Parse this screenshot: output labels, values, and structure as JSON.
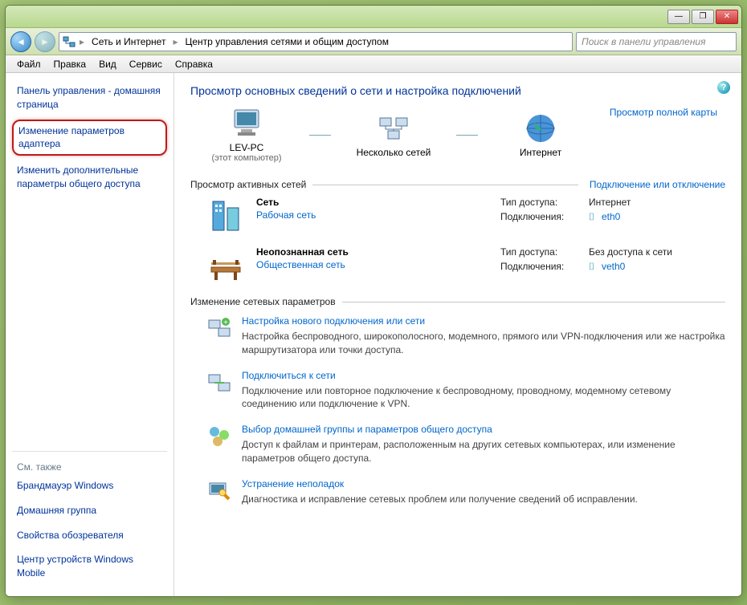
{
  "titlebar": {
    "min": "—",
    "max": "❐",
    "close": "✕"
  },
  "nav": {
    "back": "◄",
    "fwd": "►",
    "crumb1": "Сеть и Интернет",
    "crumb2": "Центр управления сетями и общим доступом",
    "search_placeholder": "Поиск в панели управления"
  },
  "menu": {
    "file": "Файл",
    "edit": "Правка",
    "view": "Вид",
    "service": "Сервис",
    "help": "Справка"
  },
  "sidebar": {
    "home": "Панель управления - домашняя страница",
    "adapter": "Изменение параметров адаптера",
    "advshare": "Изменить дополнительные параметры общего доступа",
    "seealso": "См. также",
    "firewall": "Брандмауэр Windows",
    "homegroup": "Домашняя группа",
    "browser": "Свойства обозревателя",
    "mobile": "Центр устройств Windows Mobile"
  },
  "content": {
    "heading": "Просмотр основных сведений о сети и настройка подключений",
    "fullmap": "Просмотр полной карты",
    "map": {
      "pc": "LEV-PC",
      "pc_sub": "(этот компьютер)",
      "multi": "Несколько сетей",
      "internet": "Интернет"
    },
    "activeHdr": "Просмотр активных сетей",
    "connToggle": "Подключение или отключение",
    "net1": {
      "title": "Сеть",
      "type": "Рабочая сеть",
      "accessK": "Тип доступа:",
      "accessV": "Интернет",
      "connK": "Подключения:",
      "connV": "eth0"
    },
    "net2": {
      "title": "Неопознанная сеть",
      "type": "Общественная сеть",
      "accessK": "Тип доступа:",
      "accessV": "Без доступа к сети",
      "connK": "Подключения:",
      "connV": "veth0"
    },
    "changeHdr": "Изменение сетевых параметров",
    "task1": {
      "title": "Настройка нового подключения или сети",
      "desc": "Настройка беспроводного, широкополосного, модемного, прямого или VPN-подключения или же настройка маршрутизатора или точки доступа."
    },
    "task2": {
      "title": "Подключиться к сети",
      "desc": "Подключение или повторное подключение к беспроводному, проводному, модемному сетевому соединению или подключение к VPN."
    },
    "task3": {
      "title": "Выбор домашней группы и параметров общего доступа",
      "desc": "Доступ к файлам и принтерам, расположенным на других сетевых компьютерах, или изменение параметров общего доступа."
    },
    "task4": {
      "title": "Устранение неполадок",
      "desc": "Диагностика и исправление сетевых проблем или получение сведений об исправлении."
    }
  }
}
